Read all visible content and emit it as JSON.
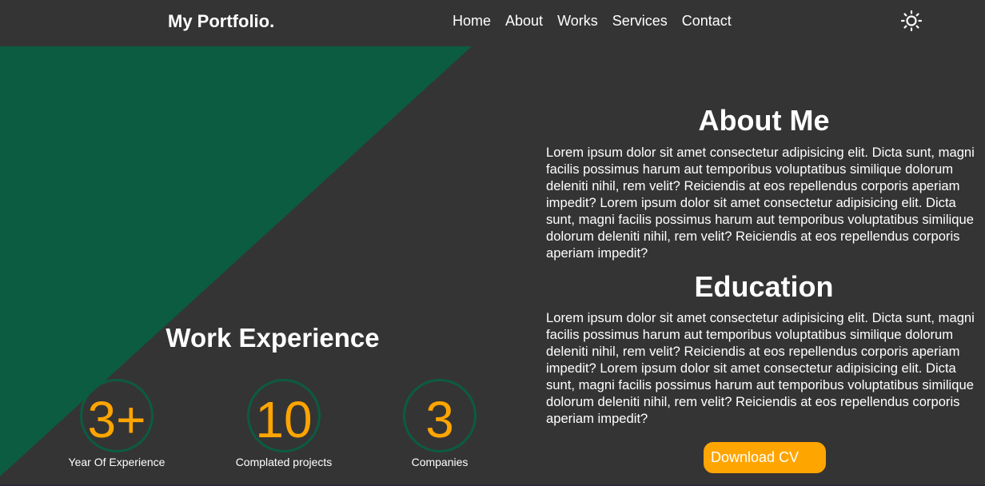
{
  "navbar": {
    "brand": "My Portfolio.",
    "links": [
      "Home",
      "About",
      "Works",
      "Services",
      "Contact"
    ],
    "theme_icon": "sun-icon"
  },
  "colors": {
    "background": "#353434",
    "accent_green": "#0b5c41",
    "accent_orange": "#ffa500",
    "text": "#ffffff"
  },
  "work_experience": {
    "title": "Work Experience",
    "stats": [
      {
        "value": "3+",
        "label": "Year Of Experience"
      },
      {
        "value": "10",
        "label": "Complated projects"
      },
      {
        "value": "3",
        "label": "Companies"
      }
    ]
  },
  "about": {
    "title": "About Me",
    "text": "Lorem ipsum dolor sit amet consectetur adipisicing elit. Dicta sunt, magni facilis possimus harum aut temporibus voluptatibus similique dolorum deleniti nihil, rem velit? Reiciendis at eos repellendus corporis aperiam impedit? Lorem ipsum dolor sit amet consectetur adipisicing elit. Dicta sunt, magni facilis possimus harum aut temporibus voluptatibus similique dolorum deleniti nihil, rem velit? Reiciendis at eos repellendus corporis aperiam impedit?"
  },
  "education": {
    "title": "Education",
    "text": "Lorem ipsum dolor sit amet consectetur adipisicing elit. Dicta sunt, magni facilis possimus harum aut temporibus voluptatibus similique dolorum deleniti nihil, rem velit? Reiciendis at eos repellendus corporis aperiam impedit? Lorem ipsum dolor sit amet consectetur adipisicing elit. Dicta sunt, magni facilis possimus harum aut temporibus voluptatibus similique dolorum deleniti nihil, rem velit? Reiciendis at eos repellendus corporis aperiam impedit?"
  },
  "download_button": "Download CV"
}
